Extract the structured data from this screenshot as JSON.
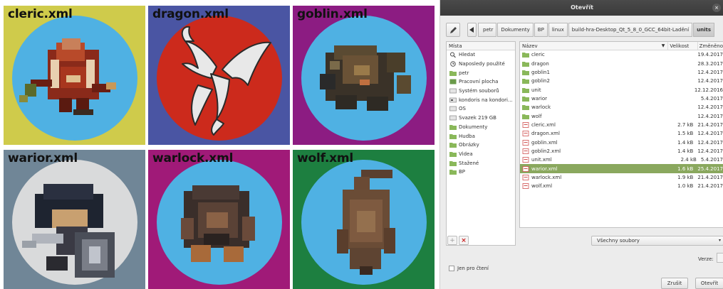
{
  "tiles": [
    {
      "label": "cleric.xml",
      "bg": "#cfcb4b",
      "circle": "#4fb1e3",
      "creature": "cleric"
    },
    {
      "label": "dragon.xml",
      "bg": "#4a55a3",
      "circle": "#cc2a1c",
      "creature": "dragon"
    },
    {
      "label": "goblin.xml",
      "bg": "#8c1c82",
      "circle": "#4fb1e3",
      "creature": "goblin"
    },
    {
      "label": "warior.xml",
      "bg": "#708697",
      "circle": "#d9dadb",
      "creature": "warior"
    },
    {
      "label": "warlock.xml",
      "bg": "#a01a78",
      "circle": "#4fb1e3",
      "creature": "warlock"
    },
    {
      "label": "wolf.xml",
      "bg": "#1d7f40",
      "circle": "#4fb1e3",
      "creature": "wolf"
    }
  ],
  "dialog": {
    "title": "Otevřít",
    "close_glyph": "×",
    "path": {
      "crumbs": [
        "petr",
        "Dokumenty",
        "BP",
        "linux",
        "build-hra-Desktop_Qt_5_8_0_GCC_64bit-Ladění",
        "units"
      ],
      "active_index": 5
    },
    "places": {
      "header": "Místa",
      "items": [
        {
          "label": "Hledat",
          "icon": "search-icon"
        },
        {
          "label": "Naposledy použité",
          "icon": "recent-icon"
        },
        {
          "label": "petr",
          "icon": "home-folder-icon"
        },
        {
          "label": "Pracovní plocha",
          "icon": "desktop-icon"
        },
        {
          "label": "Systém souborů",
          "icon": "drive-icon"
        },
        {
          "label": "kondoris na kondori...",
          "icon": "network-drive-icon"
        },
        {
          "label": "OS",
          "icon": "drive-icon"
        },
        {
          "label": "Svazek 219 GB",
          "icon": "drive-icon"
        },
        {
          "label": "Dokumenty",
          "icon": "documents-folder-icon"
        },
        {
          "label": "Hudba",
          "icon": "music-folder-icon"
        },
        {
          "label": "Obrázky",
          "icon": "pictures-folder-icon"
        },
        {
          "label": "Videa",
          "icon": "videos-folder-icon"
        },
        {
          "label": "Stažené",
          "icon": "downloads-folder-icon"
        },
        {
          "label": "BP",
          "icon": "folder-icon"
        }
      ],
      "add_glyph": "+",
      "remove_glyph": "×"
    },
    "files": {
      "columns": {
        "name": "Název",
        "size": "Velikost",
        "date": "Změněno"
      },
      "sort_glyph": "▼",
      "rows": [
        {
          "name": "cleric",
          "size": "",
          "date": "19.4.2017",
          "kind": "folder"
        },
        {
          "name": "dragon",
          "size": "",
          "date": "28.3.2017",
          "kind": "folder"
        },
        {
          "name": "goblin1",
          "size": "",
          "date": "12.4.2017",
          "kind": "folder"
        },
        {
          "name": "goblin2",
          "size": "",
          "date": "12.4.2017",
          "kind": "folder"
        },
        {
          "name": "unit",
          "size": "",
          "date": "12.12.2016",
          "kind": "folder"
        },
        {
          "name": "warior",
          "size": "",
          "date": "5.4.2017",
          "kind": "folder"
        },
        {
          "name": "warlock",
          "size": "",
          "date": "12.4.2017",
          "kind": "folder"
        },
        {
          "name": "wolf",
          "size": "",
          "date": "12.4.2017",
          "kind": "folder"
        },
        {
          "name": "cleric.xml",
          "size": "2.7 kB",
          "date": "21.4.2017",
          "kind": "xml"
        },
        {
          "name": "dragon.xml",
          "size": "1.5 kB",
          "date": "12.4.2017",
          "kind": "xml"
        },
        {
          "name": "goblin.xml",
          "size": "1.4 kB",
          "date": "12.4.2017",
          "kind": "xml"
        },
        {
          "name": "goblin2.xml",
          "size": "1.4 kB",
          "date": "12.4.2017",
          "kind": "xml"
        },
        {
          "name": "unit.xml",
          "size": "2.4 kB",
          "date": "5.4.2017",
          "kind": "xml"
        },
        {
          "name": "warior.xml",
          "size": "1.6 kB",
          "date": "25.4.2017",
          "kind": "xml",
          "selected": true
        },
        {
          "name": "warlock.xml",
          "size": "1.9 kB",
          "date": "21.4.2017",
          "kind": "xml"
        },
        {
          "name": "wolf.xml",
          "size": "1.0 kB",
          "date": "21.4.2017",
          "kind": "xml"
        }
      ]
    },
    "filter": {
      "value": "Všechny soubory",
      "arrow": "▾"
    },
    "version_label": "Verze:",
    "readonly_label": "Jen pro čtení",
    "cancel_label": "Zrušit",
    "open_label": "Otevřít",
    "colors": {
      "selection": "#8aa85e",
      "folder": "#8ab85a",
      "xml": "#d05050"
    }
  }
}
